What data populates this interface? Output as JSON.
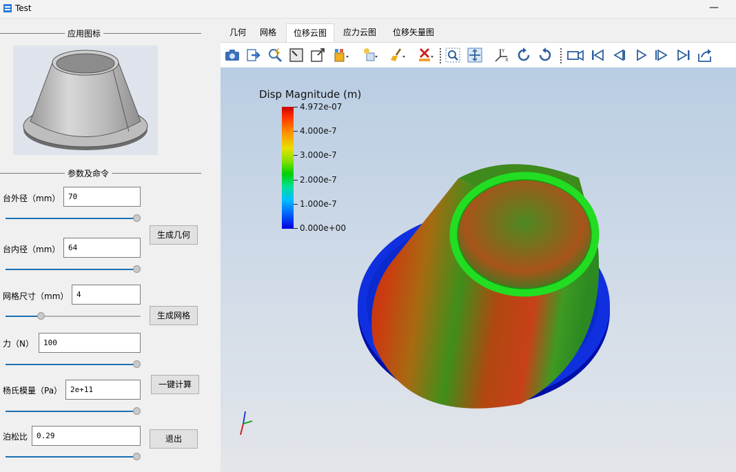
{
  "window": {
    "title": "Test",
    "minimize_glyph": "—"
  },
  "left_panel": {
    "icon_group_title": "应用图标",
    "params_group_title": "参数及命令",
    "fields": [
      {
        "label": "台外径（mm）",
        "value": "70",
        "slider": 1.0
      },
      {
        "label": "台内径（mm）",
        "value": "64",
        "slider": 1.0
      },
      {
        "label": "网格尺寸（mm）",
        "value": "4",
        "slider": 0.25
      },
      {
        "label": "力（N）",
        "value": "100",
        "slider": 1.0
      },
      {
        "label": "杨氏模量（Pa）",
        "value": "2e+11",
        "slider": 1.0
      },
      {
        "label": "泊松比",
        "value": "0.29",
        "slider": 1.0
      }
    ],
    "buttons": {
      "generate_geometry": "生成几何",
      "generate_mesh": "生成网格",
      "one_click_compute": "一键计算",
      "exit": "退出"
    }
  },
  "tabs": [
    {
      "label": "几何",
      "active": false
    },
    {
      "label": "网格",
      "active": false
    },
    {
      "label": "位移云图",
      "active": true
    },
    {
      "label": "应力云图",
      "active": false
    },
    {
      "label": "位移矢量图",
      "active": false
    }
  ],
  "toolbar_icons": [
    "camera-icon",
    "export-icon",
    "magnify-pick-icon",
    "fit-view-icon",
    "box-zoom-icon",
    "display-mode-icon",
    "light-icon",
    "clear-brush-icon",
    "clear-selection-icon",
    "zoom-region-icon",
    "fit-all-icon",
    "axes-icon",
    "rotate-cw-icon",
    "rotate-ccw-icon",
    "record-icon",
    "first-frame-icon",
    "prev-frame-icon",
    "play-icon",
    "next-frame-icon",
    "last-frame-icon",
    "export-animation-icon"
  ],
  "legend": {
    "title": "Disp Magnitude (m)",
    "ticks": [
      "4.972e-07",
      "4.000e-7",
      "3.000e-7",
      "2.000e-7",
      "1.000e-7",
      "0.000e+00"
    ]
  },
  "colors": {
    "accent": "#1c6fb0",
    "max": "#c80000",
    "min": "#0000dd",
    "ring": "#22dd22"
  }
}
